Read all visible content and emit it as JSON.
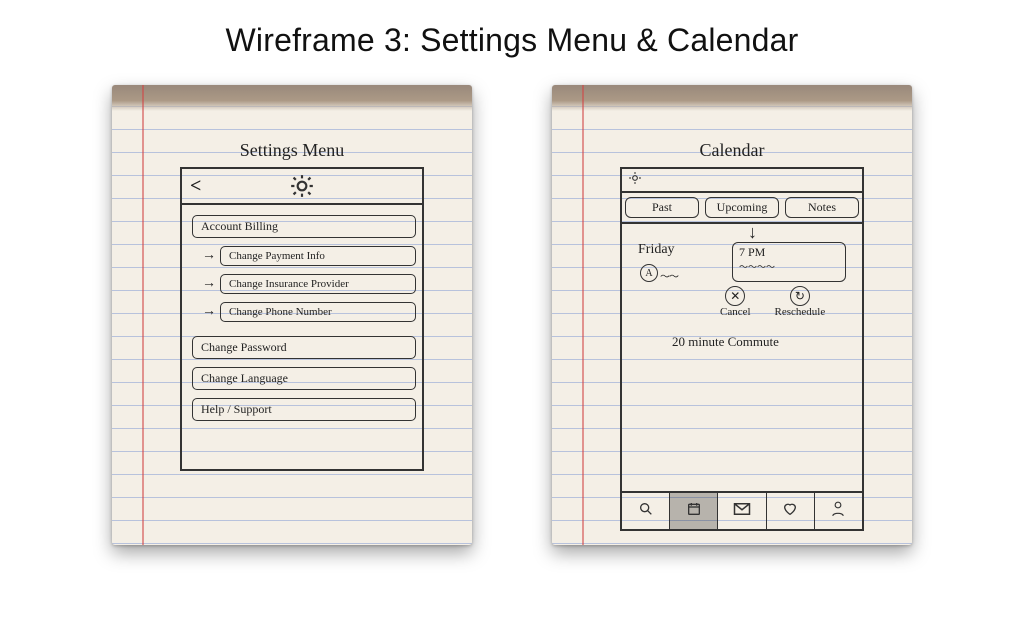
{
  "title": "Wireframe 3: Settings Menu & Calendar",
  "settings": {
    "sketch_title": "Settings Menu",
    "back_glyph": "<",
    "items": {
      "account_billing": "Account Billing",
      "change_payment": "Change Payment Info",
      "change_insurance": "Change Insurance Provider",
      "change_phone": "Change Phone Number",
      "change_password": "Change Password",
      "change_language": "Change Language",
      "help_support": "Help / Support"
    }
  },
  "calendar": {
    "sketch_title": "Calendar",
    "tabs": {
      "past": "Past",
      "upcoming": "Upcoming",
      "notes": "Notes"
    },
    "day": "Friday",
    "avatar_glyph": "A",
    "appointment_time": "7 PM",
    "actions": {
      "cancel": "Cancel",
      "reschedule": "Reschedule"
    },
    "commute": "20 minute Commute",
    "nav_icons": {
      "search": "search-icon",
      "calendar": "calendar-icon",
      "mail": "mail-icon",
      "favorites": "heart-icon",
      "profile": "person-icon"
    }
  }
}
